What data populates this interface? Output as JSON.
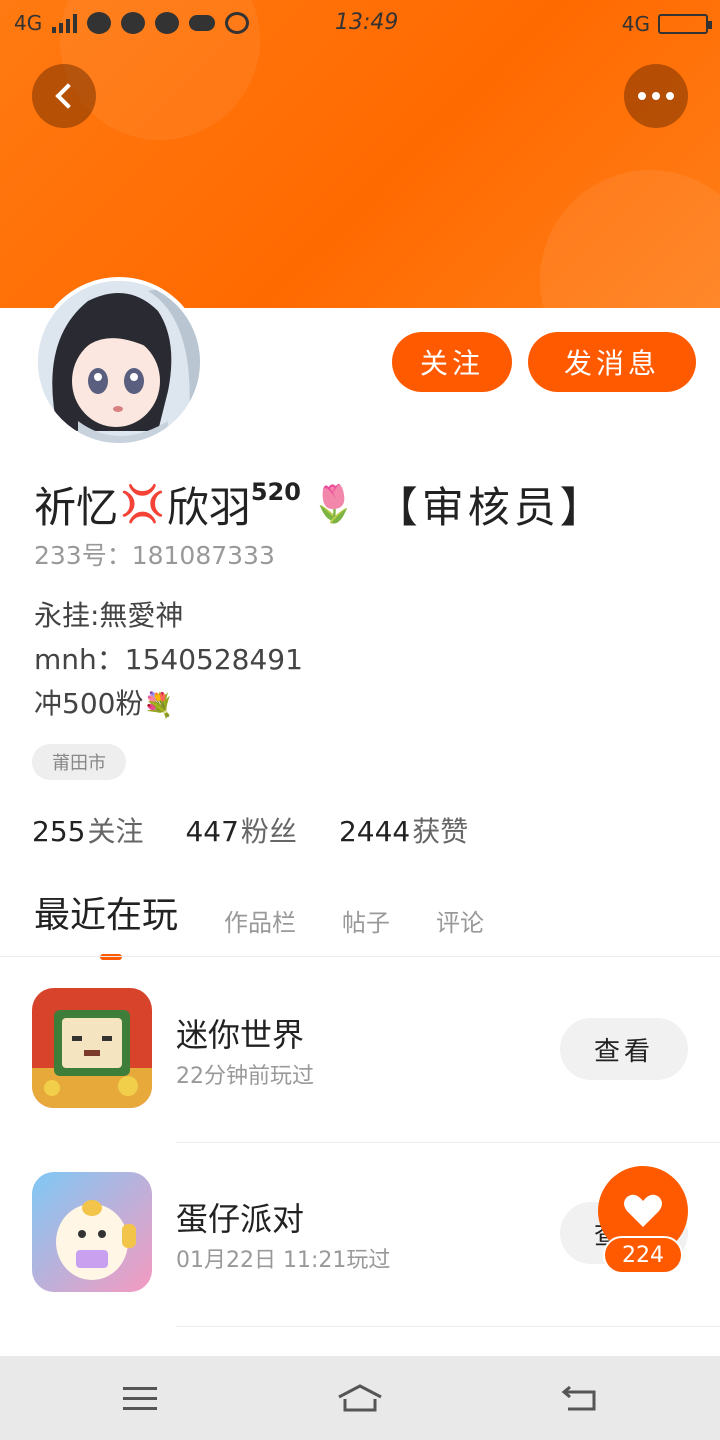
{
  "status_bar": {
    "network_left": "4G",
    "time": "13:49",
    "network_right": "4G"
  },
  "header": {
    "back_icon": "chevron-left-icon",
    "more_icon": "more-horizontal-icon",
    "accent_color": "#ff6a00"
  },
  "profile": {
    "name": "祈忆",
    "name_mid": "欣羽",
    "name_sup": "520",
    "role": "【审核员】",
    "uid": "233号：181087333",
    "bio": [
      "永挂:無愛神",
      "mnh：1540528491",
      "冲500粉"
    ],
    "location": "莆田市",
    "follow_label": "关注",
    "message_label": "发消息"
  },
  "stats": [
    {
      "value": "255",
      "label": "关注"
    },
    {
      "value": "447",
      "label": "粉丝"
    },
    {
      "value": "2444",
      "label": "获赞"
    }
  ],
  "tabs": [
    "最近在玩",
    "作品栏",
    "帖子",
    "评论"
  ],
  "games": [
    {
      "name": "迷你世界",
      "meta": "22分钟前玩过",
      "action": "查看"
    },
    {
      "name": "蛋仔派对",
      "meta": "01月22日 11:21玩过",
      "action": "查看"
    }
  ],
  "like": {
    "count": "224",
    "icon": "heart-icon"
  },
  "nav": {
    "menu_icon": "menu-icon",
    "home_icon": "home-icon",
    "back_icon": "return-icon"
  }
}
